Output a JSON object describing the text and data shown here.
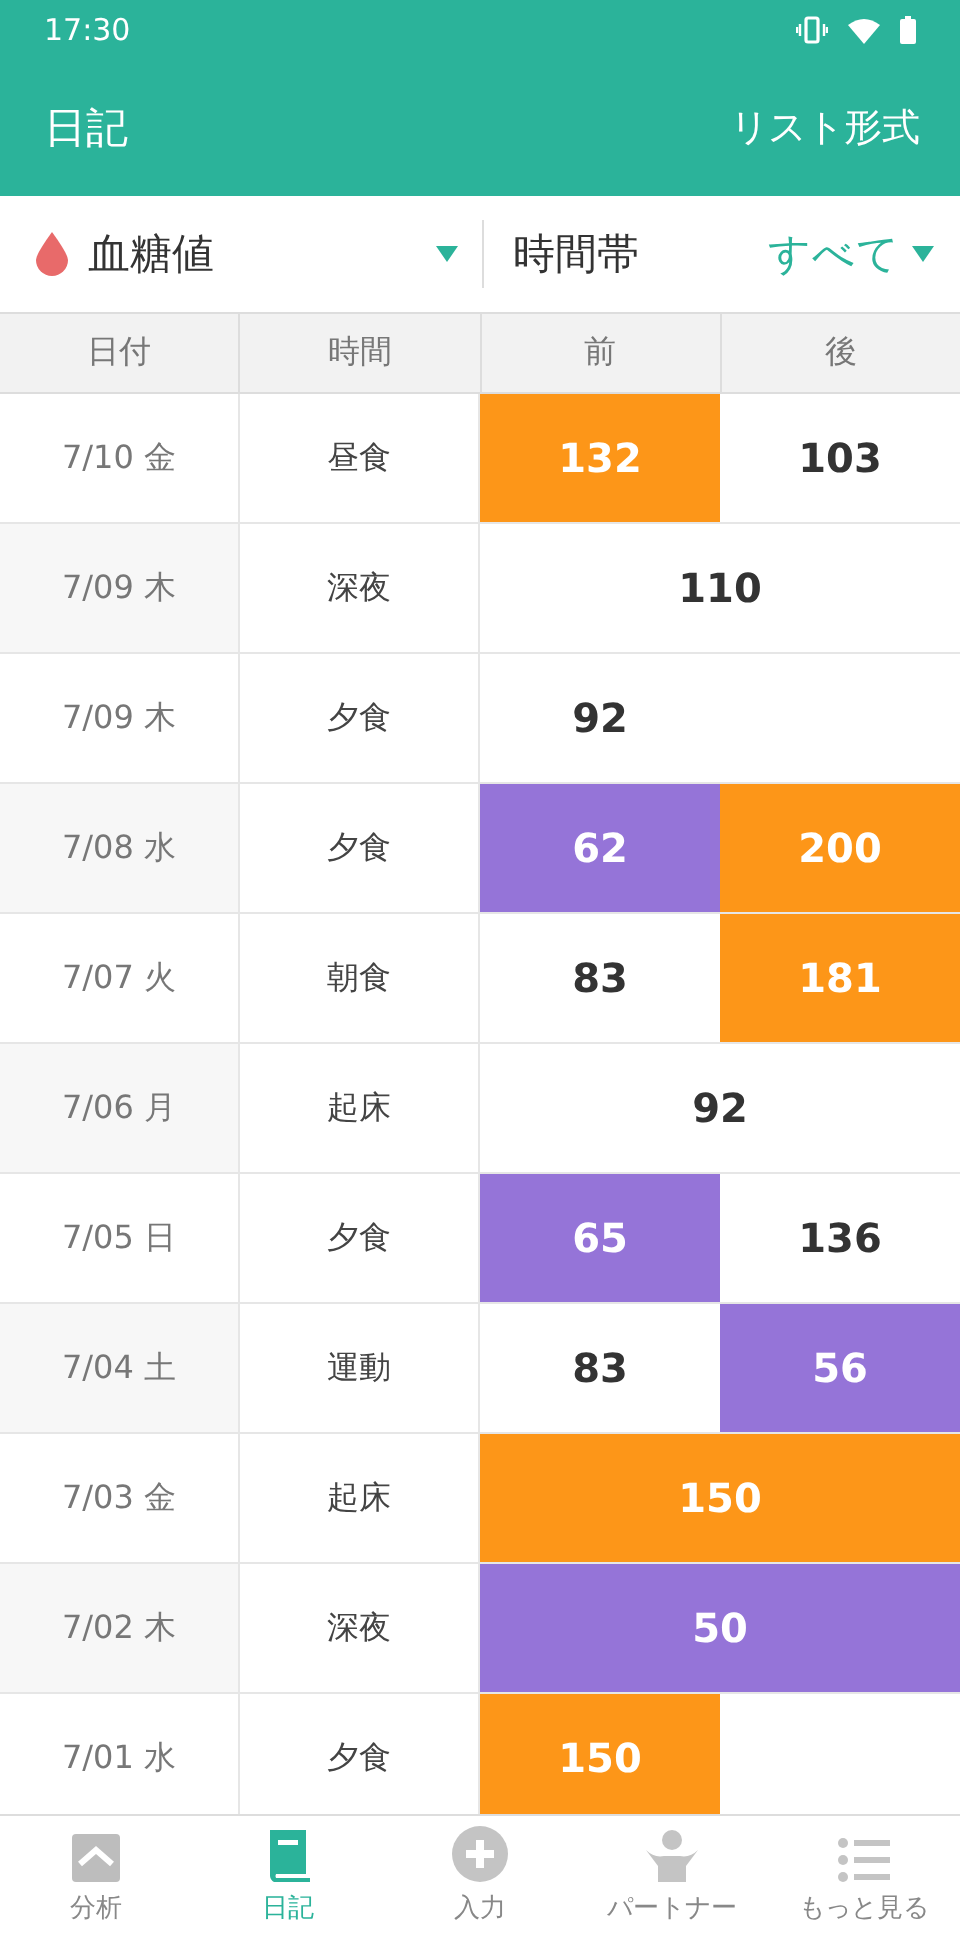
{
  "status_bar": {
    "time": "17:30"
  },
  "header": {
    "title": "日記",
    "action": "リスト形式"
  },
  "filters": {
    "measure": "血糖値",
    "period_label": "時間帯",
    "period_value": "すべて"
  },
  "table": {
    "columns": [
      "日付",
      "時間",
      "前",
      "後"
    ],
    "rows": [
      {
        "date": "7/10 金",
        "time": "昼食",
        "kind": "split",
        "before": {
          "text": "132",
          "color": "#fd9618"
        },
        "after": {
          "text": "103"
        }
      },
      {
        "date": "7/09 木",
        "time": "深夜",
        "kind": "merged",
        "value": {
          "text": "110"
        }
      },
      {
        "date": "7/09 木",
        "time": "夕食",
        "kind": "split",
        "before": {
          "text": "92"
        }
      },
      {
        "date": "7/08 水",
        "time": "夕食",
        "kind": "split",
        "before": {
          "text": "62",
          "color": "#9574d8"
        },
        "after": {
          "text": "200",
          "color": "#fd9618"
        }
      },
      {
        "date": "7/07 火",
        "time": "朝食",
        "kind": "split",
        "before": {
          "text": "83"
        },
        "after": {
          "text": "181",
          "color": "#fd9618"
        }
      },
      {
        "date": "7/06 月",
        "time": "起床",
        "kind": "merged",
        "value": {
          "text": "92"
        }
      },
      {
        "date": "7/05 日",
        "time": "夕食",
        "kind": "split",
        "before": {
          "text": "65",
          "color": "#9574d8"
        },
        "after": {
          "text": "136"
        }
      },
      {
        "date": "7/04 土",
        "time": "運動",
        "kind": "split",
        "before": {
          "text": "83"
        },
        "after": {
          "text": "56",
          "color": "#9574d8"
        }
      },
      {
        "date": "7/03 金",
        "time": "起床",
        "kind": "merged",
        "value": {
          "text": "150",
          "color": "#fd9618"
        }
      },
      {
        "date": "7/02 木",
        "time": "深夜",
        "kind": "merged",
        "value": {
          "text": "50",
          "color": "#9574d8"
        }
      },
      {
        "date": "7/01 水",
        "time": "夕食",
        "kind": "split",
        "before": {
          "text": "150",
          "color": "#fd9618"
        }
      }
    ]
  },
  "tab_bar": [
    {
      "label": "分析",
      "kind": "chart",
      "selected": false
    },
    {
      "label": "日記",
      "kind": "book",
      "selected": true
    },
    {
      "label": "入力",
      "kind": "plus",
      "selected": false
    },
    {
      "label": "パートナー",
      "kind": "person",
      "selected": false
    },
    {
      "label": "もっと見る",
      "kind": "list",
      "selected": false
    }
  ]
}
